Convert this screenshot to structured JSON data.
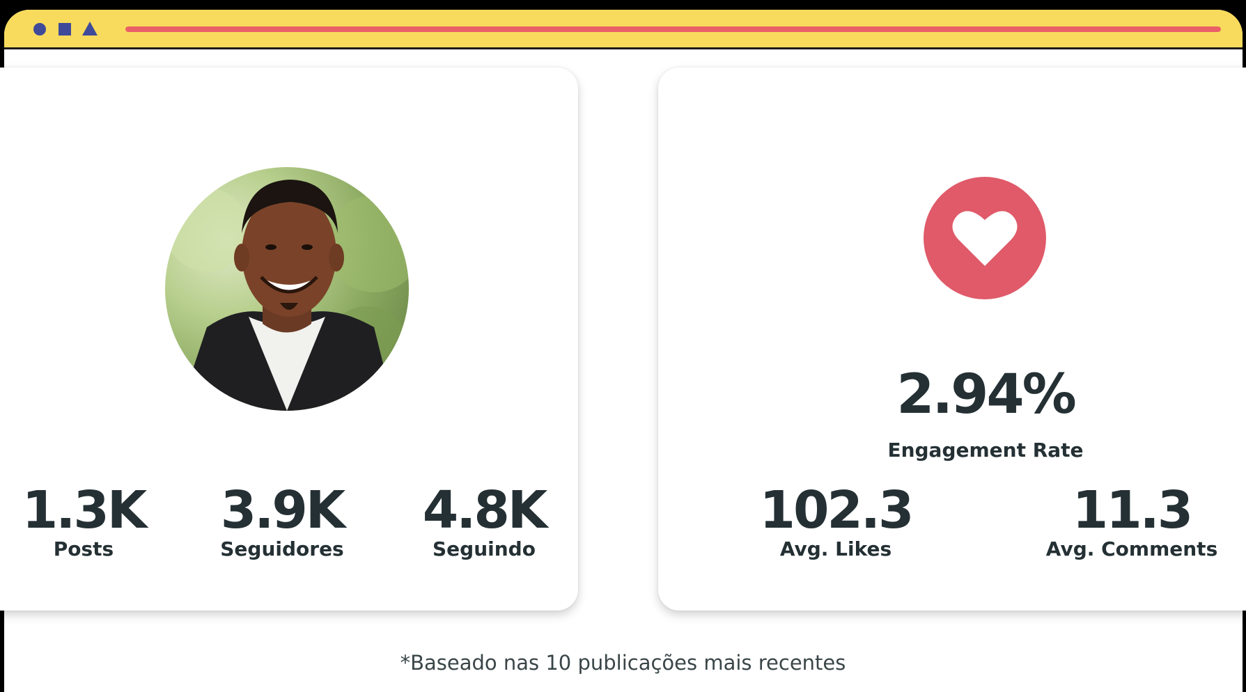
{
  "window": {
    "controls": [
      "circle",
      "square",
      "triangle"
    ],
    "progress_fraction": 1.0,
    "colors": {
      "titlebar": "#f8db5c",
      "controls": "#3f4a99",
      "progress": "#ea6067"
    }
  },
  "profile": {
    "avatar_description": "profile photo",
    "stats": [
      {
        "value": "1.3K",
        "label": "Posts"
      },
      {
        "value": "3.9K",
        "label": "Seguidores"
      },
      {
        "value": "4.8K",
        "label": "Seguindo"
      }
    ]
  },
  "engagement": {
    "icon": "heart-icon",
    "icon_color": "#e05a69",
    "rate": "2.94%",
    "rate_label": "Engagement Rate",
    "stats": [
      {
        "value": "102.3",
        "label": "Avg. Likes"
      },
      {
        "value": "11.3",
        "label": "Avg. Comments"
      }
    ]
  },
  "footnote": "*Baseado nas 10 publicações mais recentes"
}
